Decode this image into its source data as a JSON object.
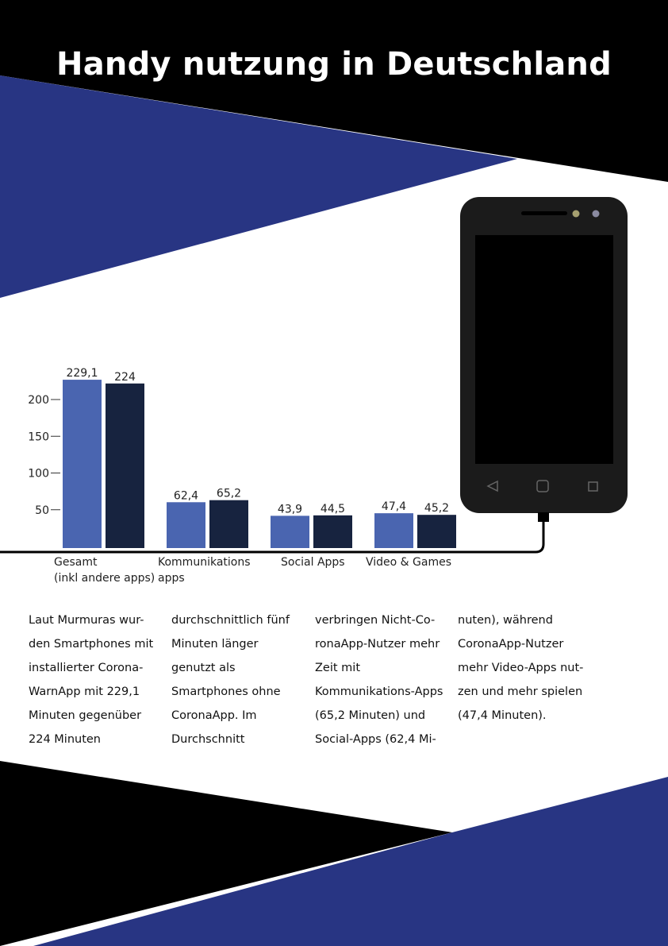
{
  "page": {
    "title": "Handy nutzung in Deutschland"
  },
  "colors": {
    "black": "#000000",
    "navy_bg": "#283583",
    "series_light": "#4a65b0",
    "series_dark": "#17233f",
    "phone_body": "#1b1b1b",
    "phone_screen": "#000000"
  },
  "chart_data": {
    "type": "bar",
    "categories": [
      [
        "Gesamt",
        "(inkl andere apps)"
      ],
      [
        "Kommunikations",
        "apps"
      ],
      [
        "Social Apps"
      ],
      [
        "Video & Games"
      ]
    ],
    "series": [
      {
        "values": [
          229.1,
          62.4,
          43.9,
          47.4
        ],
        "labels": [
          "229,1",
          "62,4",
          "43,9",
          "47,4"
        ],
        "color": "#4a65b0"
      },
      {
        "values": [
          224,
          65.2,
          44.5,
          45.2
        ],
        "labels": [
          "224",
          "65,2",
          "44,5",
          "45,2"
        ],
        "color": "#17233f"
      }
    ],
    "yticks": [
      50,
      100,
      150,
      200
    ],
    "ylim": [
      0,
      240
    ],
    "grid": false,
    "legend": "none"
  },
  "body_text": {
    "columns": [
      [
        "Laut Murmuras wur-",
        "den Smartphones mit",
        "installierter Corona-",
        "WarnApp mit 229,1",
        "Minuten gegenüber",
        "224 Minuten"
      ],
      [
        "durchschnittlich fünf",
        "Minuten länger",
        "genutzt als",
        "Smartphones ohne",
        "CoronaApp. Im",
        "Durchschnitt"
      ],
      [
        "verbringen Nicht-Co-",
        "ronaApp-Nutzer mehr",
        "Zeit mit",
        "Kommunikations-Apps",
        "(65,2 Minuten) und",
        "Social-Apps (62,4 Mi-"
      ],
      [
        "nuten), während",
        "CoronaApp-Nutzer",
        "mehr Video-Apps nut-",
        "zen und mehr spielen",
        "(47,4 Minuten)."
      ]
    ]
  }
}
